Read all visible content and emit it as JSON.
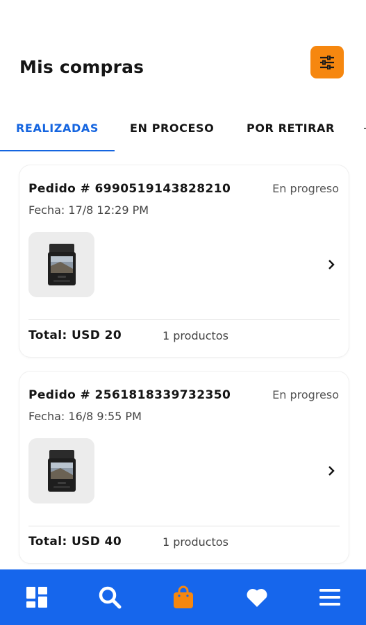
{
  "header": {
    "title": "Mis compras",
    "filter_icon": "sliders-icon",
    "accent_color": "#f6870f"
  },
  "tabs": [
    {
      "label": "REALIZADAS",
      "active": true
    },
    {
      "label": "EN PROCESO",
      "active": false
    },
    {
      "label": "POR RETIRAR",
      "active": false
    }
  ],
  "orders": [
    {
      "id": "Pedido # 6990519143828210",
      "status": "En progreso",
      "date": "Fecha: 17/8 12:29 PM",
      "total": "Total: USD 20",
      "count": "1 productos"
    },
    {
      "id": "Pedido # 2561818339732350",
      "status": "En progreso",
      "date": "Fecha: 16/8 9:55 PM",
      "total": "Total: USD 40",
      "count": "1 productos"
    }
  ],
  "bottom_nav": {
    "background": "#1666ec",
    "items": [
      {
        "icon": "dashboard-icon",
        "active": false
      },
      {
        "icon": "search-icon",
        "active": false
      },
      {
        "icon": "shopping-bag-icon",
        "active": true
      },
      {
        "icon": "heart-icon",
        "active": false
      },
      {
        "icon": "menu-icon",
        "active": false
      }
    ]
  }
}
